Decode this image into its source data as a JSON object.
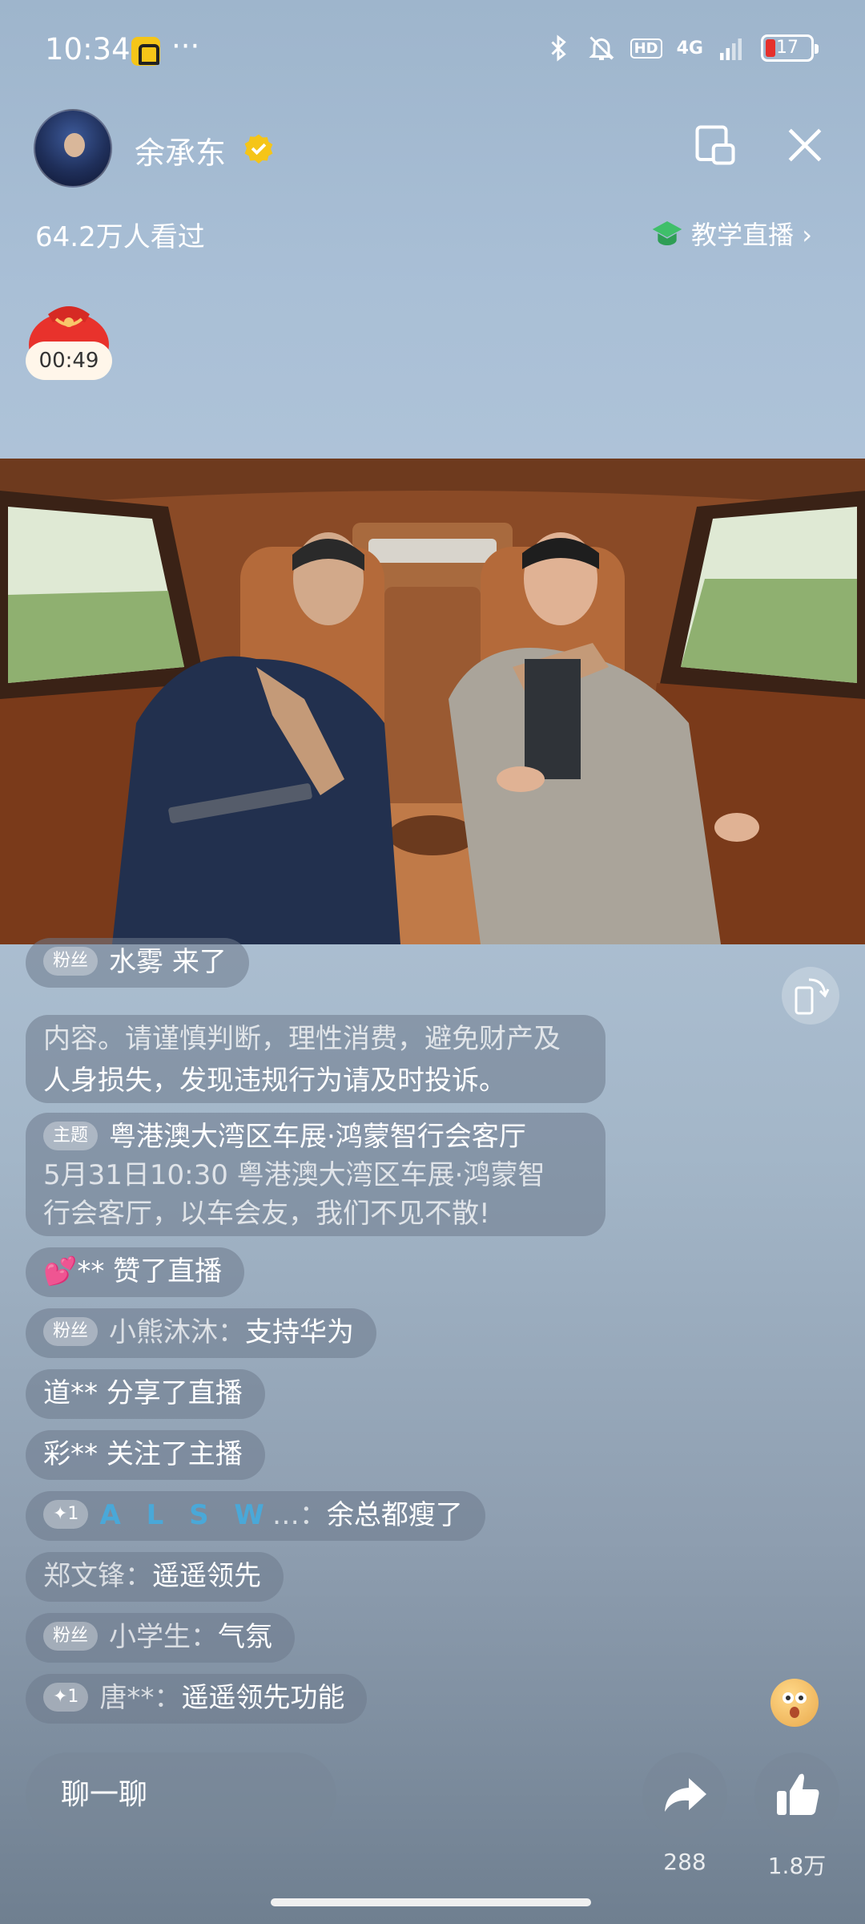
{
  "status_bar": {
    "time": "10:34",
    "more": "···",
    "network": "4G",
    "hd": "HD",
    "battery": "17",
    "battery_color": "#e5302c"
  },
  "header": {
    "streamer_name": "余承东",
    "view_count": "64.2万人看过",
    "edu_tag": "教学直播 ›",
    "verified_color": "#f5c518"
  },
  "red_packet": {
    "timer": "00:49"
  },
  "chat": {
    "fan_badge": "粉丝",
    "plus_badge": "✦1",
    "topic_badge": "主题",
    "entry_name": "水雾",
    "entry_action": "来了",
    "notice_line1": "内容。请谨慎判断，理性消费，避免财产及",
    "notice_line2": "人身损失，发现违规行为请及时投诉。",
    "topic_title": "粤港澳大湾区车展·鸿蒙智行会客厅",
    "topic_line2": "5月31日10:30 粤港澳大湾区车展·鸿蒙智",
    "topic_line3": "行会客厅，以车会友，我们不见不散!",
    "like_user": "💕**",
    "like_action": "赞了直播",
    "msg1_user": "小熊沐沐：",
    "msg1_text": "支持华为",
    "share_user": "道**",
    "share_action": "分享了直播",
    "follow_user": "彩**",
    "follow_action": "关注了主播",
    "msg2_user": "A L S W",
    "msg2_user_suffix": "…：",
    "msg2_text": "余总都瘦了",
    "msg3_user": "郑文锋：",
    "msg3_text": "遥遥领先",
    "msg4_user": "小学生：",
    "msg4_text": "气氛",
    "msg5_user": "唐**：",
    "msg5_text": "遥遥领先功能"
  },
  "bottom": {
    "chat_placeholder": "聊一聊",
    "share_count": "288",
    "like_count": "1.8万"
  },
  "icons": {
    "close": "close-icon",
    "pip": "pip-icon",
    "share": "share-arrow-icon",
    "like": "thumbs-up-icon",
    "rotate": "rotate-screen-icon"
  }
}
